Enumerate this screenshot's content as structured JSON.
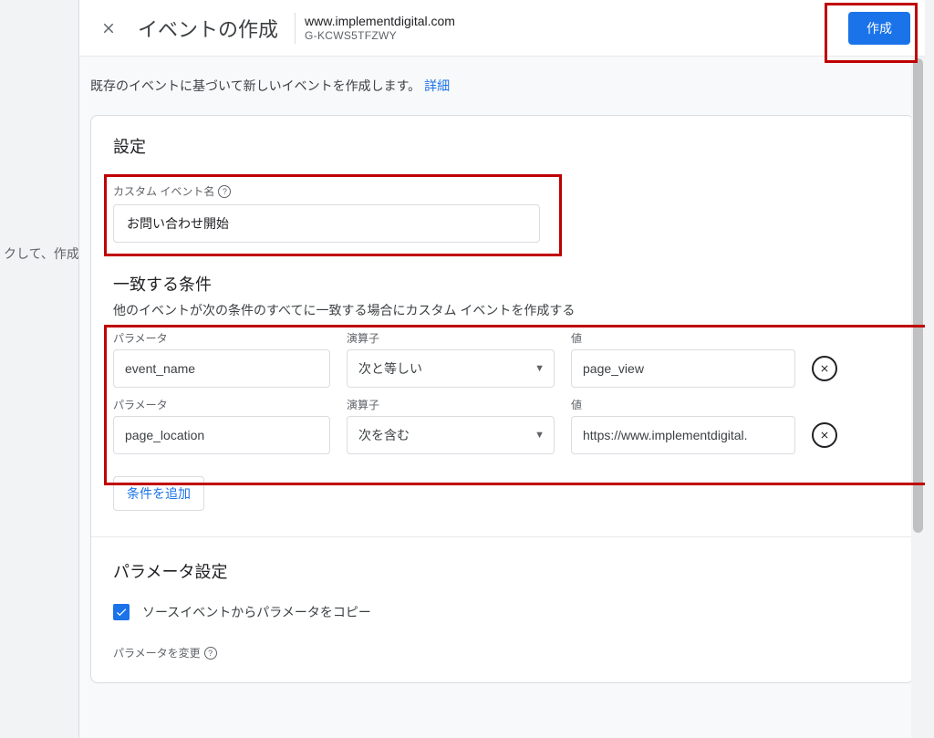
{
  "header": {
    "title": "イベントの作成",
    "property_domain": "www.implementdigital.com",
    "property_id": "G-KCWS5TFZWY",
    "create_button": "作成"
  },
  "background_hint": "クして、作成",
  "intro": {
    "text": "既存のイベントに基づいて新しいイベントを作成します。",
    "link": "詳細"
  },
  "settings": {
    "section_title": "設定",
    "custom_event_label": "カスタム イベント名",
    "custom_event_value": "お問い合わせ開始"
  },
  "matching": {
    "title": "一致する条件",
    "description": "他のイベントが次の条件のすべてに一致する場合にカスタム イベントを作成する",
    "headers": {
      "parameter": "パラメータ",
      "operator": "演算子",
      "value": "値"
    },
    "rows": [
      {
        "parameter": "event_name",
        "operator": "次と等しい",
        "value": "page_view"
      },
      {
        "parameter": "page_location",
        "operator": "次を含む",
        "value": "https://www.implementdigital."
      }
    ],
    "add_condition": "条件を追加"
  },
  "param_settings": {
    "title": "パラメータ設定",
    "copy_checkbox_label": "ソースイベントからパラメータをコピー",
    "modify_label": "パラメータを変更"
  }
}
